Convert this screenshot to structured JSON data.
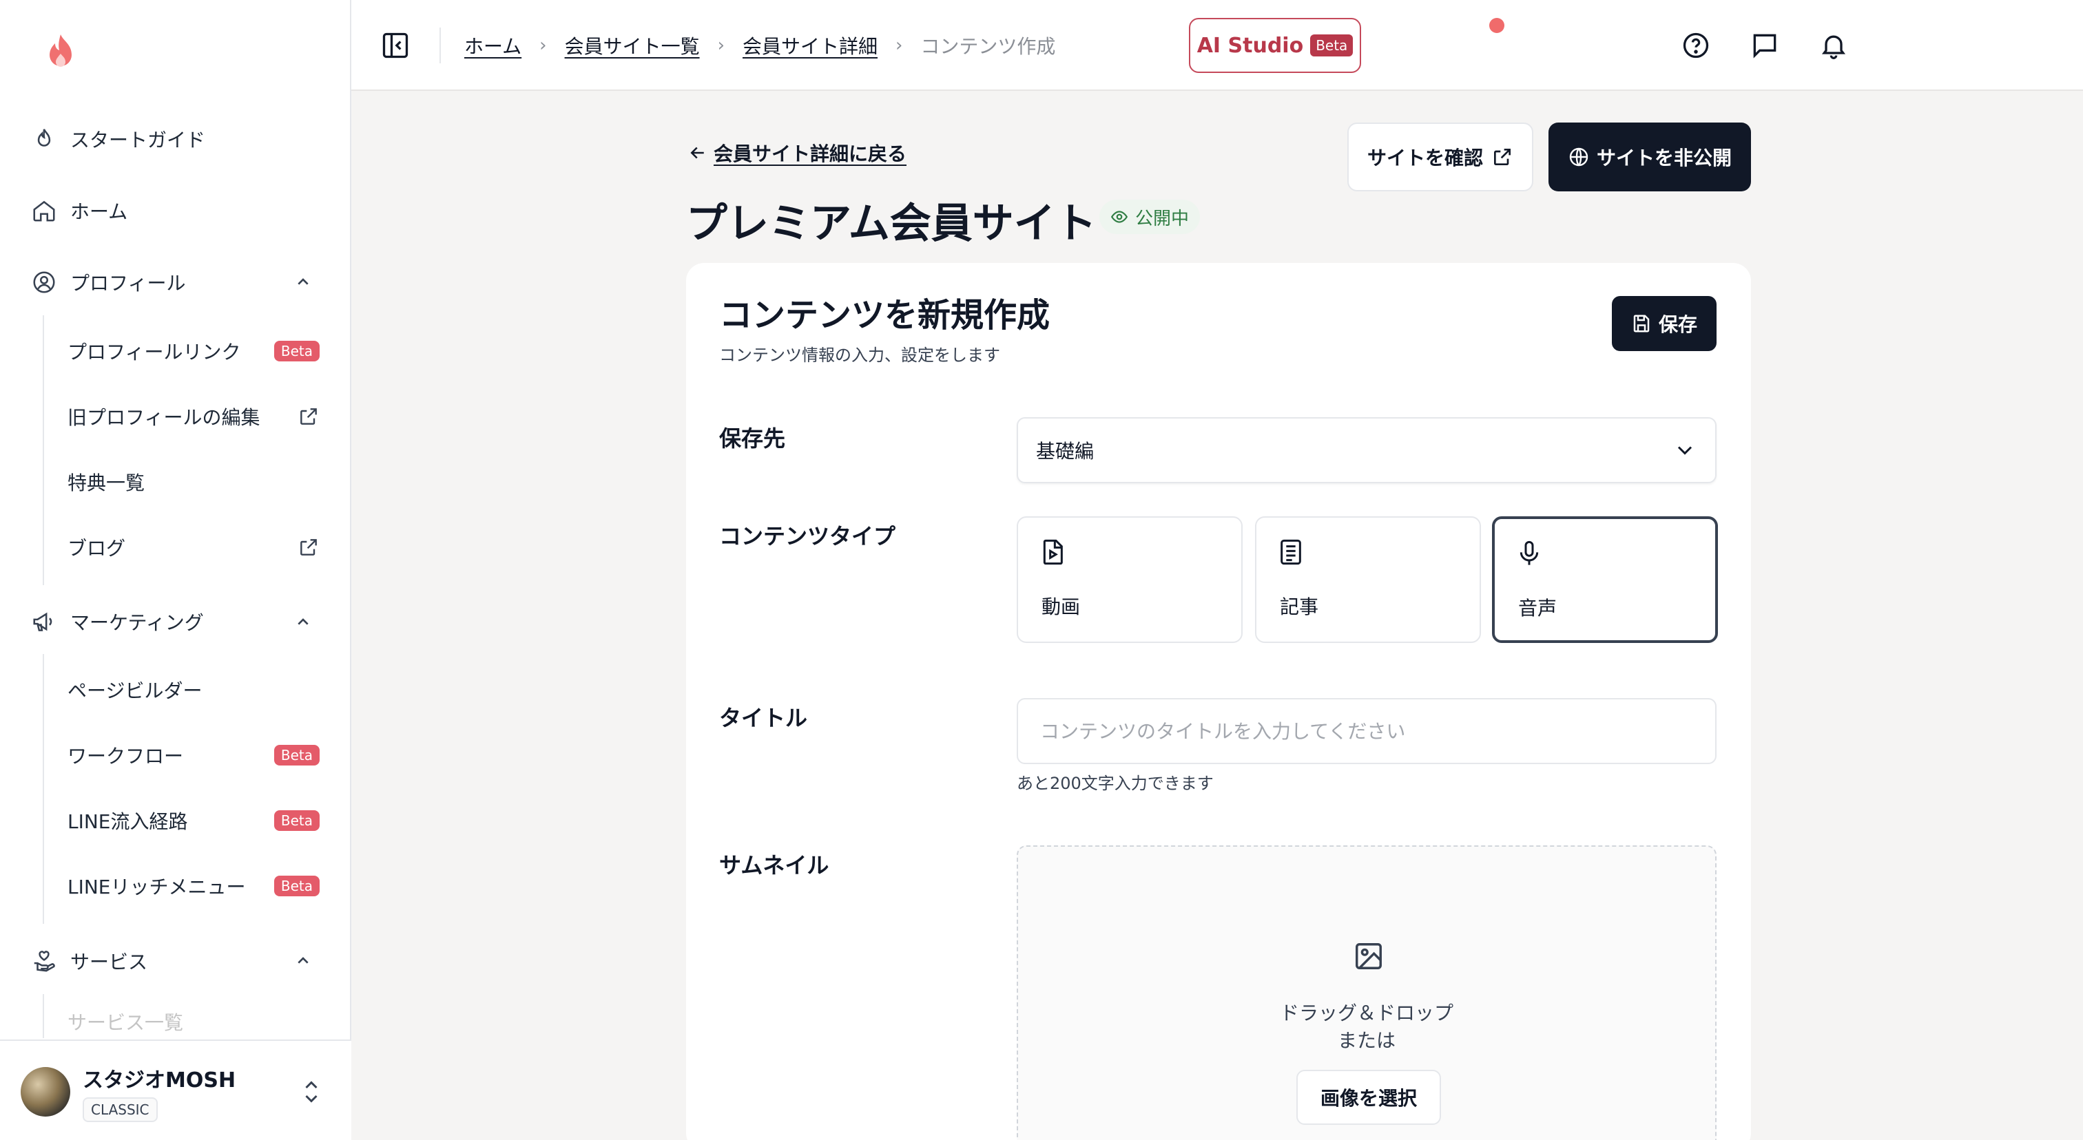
{
  "sidebar": {
    "nav": {
      "start_guide": "スタートガイド",
      "home": "ホーム",
      "profile": "プロフィール",
      "marketing": "マーケティング",
      "service": "サービス"
    },
    "profile_items": [
      {
        "label": "プロフィールリンク",
        "badge": "Beta"
      },
      {
        "label": "旧プロフィールの編集",
        "external": true
      },
      {
        "label": "特典一覧"
      },
      {
        "label": "ブログ",
        "external": true
      }
    ],
    "marketing_items": [
      {
        "label": "ページビルダー"
      },
      {
        "label": "ワークフロー",
        "badge": "Beta"
      },
      {
        "label": "LINE流入経路",
        "badge": "Beta"
      },
      {
        "label": "LINEリッチメニュー",
        "badge": "Beta"
      }
    ],
    "service_items": [
      {
        "label": "サービス一覧"
      }
    ],
    "user": {
      "name": "スタジオMOSH",
      "plan": "CLASSIC"
    }
  },
  "topbar": {
    "breadcrumb": [
      "ホーム",
      "会員サイト一覧",
      "会員サイト詳細",
      "コンテンツ作成"
    ],
    "ai_studio": {
      "label": "AI Studio",
      "badge": "Beta"
    }
  },
  "header": {
    "back_link": "会員サイト詳細に戻る",
    "view_site": "サイトを確認",
    "unpublish": "サイトを非公開",
    "title": "プレミアム会員サイト",
    "status": "公開中"
  },
  "form": {
    "title": "コンテンツを新規作成",
    "subtitle": "コンテンツ情報の入力、設定をします",
    "save": "保存",
    "labels": {
      "destination": "保存先",
      "content_type": "コンテンツタイプ",
      "title": "タイトル",
      "thumbnail": "サムネイル"
    },
    "destination_value": "基礎編",
    "content_types": [
      {
        "label": "動画",
        "icon": "video-file-icon"
      },
      {
        "label": "記事",
        "icon": "article-icon"
      },
      {
        "label": "音声",
        "icon": "microphone-icon",
        "selected": true
      }
    ],
    "title_placeholder": "コンテンツのタイトルを入力してください",
    "title_value": "",
    "title_hint": "あと200文字入力できます",
    "thumbnail": {
      "drop_line1": "ドラッグ＆ドロップ",
      "drop_line2": "または",
      "select_button": "画像を選択"
    }
  },
  "colors": {
    "primary_dark": "#111827",
    "beta_badge": "#e45b69",
    "ai_accent": "#b8384a",
    "status_green": "#2f7d43",
    "notification": "#f06b6b"
  }
}
